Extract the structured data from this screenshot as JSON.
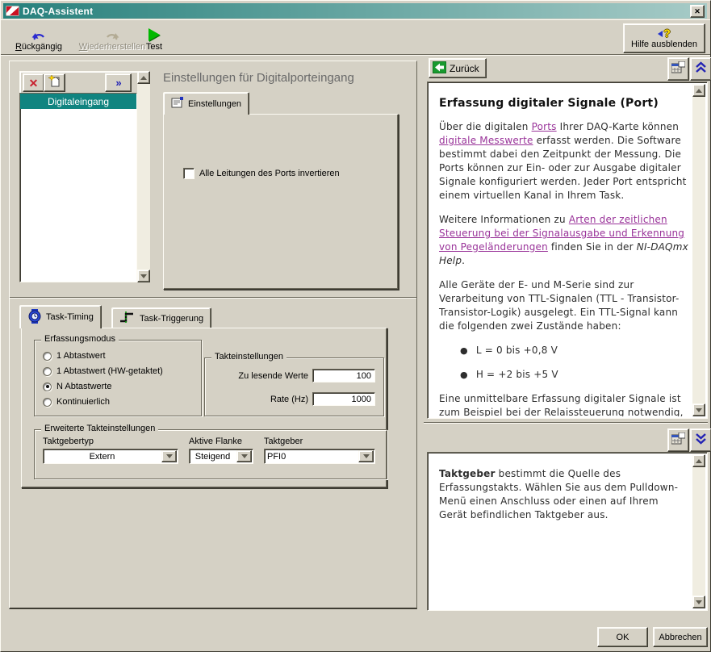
{
  "colors": {
    "face": "#d5d1c5",
    "face_light": "#fdfbf4",
    "face_dark": "#6a675a",
    "shadow_dark": "#3e3c33",
    "titlebar_start": "#26807c",
    "titlebar_end": "#a7cbc7",
    "select_teal": "#108480",
    "link": "#993399",
    "help_text": "#2e2e2e",
    "green_test": "#00b800",
    "undo_blue": "#2b2bd0",
    "red_delete": "#c8202e",
    "chevron_blue": "#2424b4",
    "scroll_track": "#f0ede1"
  },
  "icons": {
    "close": "✕",
    "delete": "✕",
    "expand": "»",
    "help_qmark": "?",
    "bullet": "●"
  },
  "window": {
    "title": "DAQ-Assistent"
  },
  "toolbar": {
    "undo": "Rückgängig",
    "redo": "Wiederherstellen",
    "test": "Test",
    "hide_help": "Hilfe ausblenden"
  },
  "channel_panel": {
    "items": [
      {
        "label": "Digitaleingang"
      }
    ]
  },
  "settings": {
    "heading": "Einstellungen für Digitalporteingang",
    "tab": "Einstellungen",
    "invert_label": "Alle Leitungen des Ports invertieren",
    "invert_checked": false
  },
  "timing": {
    "tab_timing": "Task-Timing",
    "tab_trigger": "Task-Triggerung",
    "erfassungsmodus": {
      "legend": "Erfassungsmodus",
      "options": [
        "1 Abtastwert",
        "1 Abtastwert (HW-getaktet)",
        "N Abtastwerte",
        "Kontinuierlich"
      ],
      "selected": "N Abtastwerte"
    },
    "takteinstellungen": {
      "legend": "Takteinstellungen",
      "fields": [
        {
          "label": "Zu lesende Werte",
          "value": "100"
        },
        {
          "label": "Rate (Hz)",
          "value": "1000"
        }
      ]
    },
    "erweitert": {
      "legend": "Erweiterte Takteinstellungen",
      "dropdowns": [
        {
          "label": "Taktgebertyp",
          "value": "Extern"
        },
        {
          "label": "Aktive Flanke",
          "value": "Steigend"
        },
        {
          "label": "Taktgeber",
          "value": "PFI0"
        }
      ]
    }
  },
  "help": {
    "back": "Zurück",
    "blocks": [
      {
        "type": "heading",
        "runs": [
          {
            "t": "Erfassung digitaler Signale (Port)"
          }
        ]
      },
      {
        "type": "p",
        "runs": [
          {
            "t": "Über die digitalen "
          },
          {
            "t": "Ports",
            "link": true
          },
          {
            "t": " Ihrer DAQ-Karte können "
          },
          {
            "t": "digitale Messwerte",
            "link": true
          },
          {
            "t": " erfasst werden. Die Software bestimmt dabei den Zeitpunkt der Messung. Die Ports können zur Ein- oder zur Ausgabe digitaler Signale konfiguriert werden. Jeder Port entspricht einem virtuellen Kanal in Ihrem Task."
          }
        ]
      },
      {
        "type": "p",
        "runs": [
          {
            "t": "Weitere Informationen zu "
          },
          {
            "t": "Arten der zeitlichen Steuerung bei der Signalausgabe und Erkennung von Pegeländerungen",
            "link": true
          },
          {
            "t": " finden Sie in der "
          },
          {
            "t": "NI-DAQmx Help",
            "italic": true
          },
          {
            "t": "."
          }
        ]
      },
      {
        "type": "p",
        "runs": [
          {
            "t": "Alle Geräte der E- und M-Serie sind zur Verarbeitung von TTL-Signalen (TTL - Transistor-Transistor-Logik) ausgelegt. Ein TTL-Signal kann die folgenden zwei Zustände haben:"
          }
        ]
      },
      {
        "type": "bullet",
        "runs": [
          {
            "t": "L = 0 bis +0,8 V"
          }
        ]
      },
      {
        "type": "bullet",
        "runs": [
          {
            "t": "H = +2 bis +5 V"
          }
        ]
      },
      {
        "type": "p",
        "runs": [
          {
            "t": "Eine unmittelbare Erfassung digitaler Signale ist zum Beispiel bei der Relaissteuerung notwendig, oder wenn der Zustand externer Geräte, wie zum Beispiel der eines Schaltmoduls, ermittelt werden soll."
          }
        ]
      }
    ]
  },
  "help_detail": {
    "blocks": [
      {
        "type": "p",
        "runs": [
          {
            "t": "Taktgeber",
            "bold": true
          },
          {
            "t": " bestimmt die Quelle des Erfassungstakts. Wählen Sie aus dem Pulldown-Menü einen Anschluss oder einen auf Ihrem Gerät befindlichen Taktgeber aus."
          }
        ]
      }
    ]
  },
  "footer": {
    "ok": "OK",
    "cancel": "Abbrechen"
  }
}
